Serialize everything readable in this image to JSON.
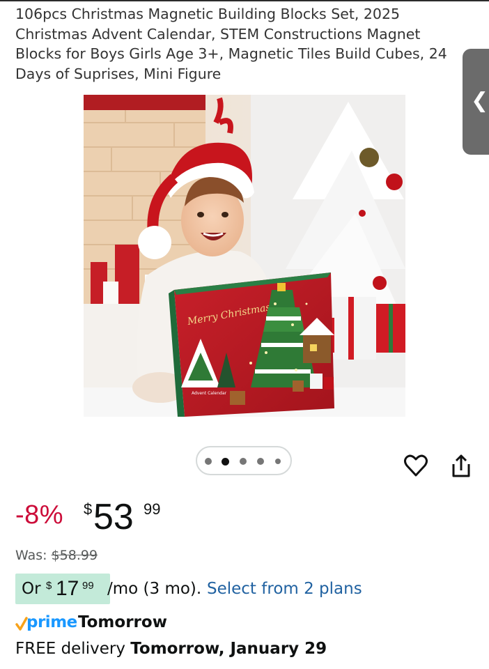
{
  "product": {
    "title": "106pcs Christmas Magnetic Building Blocks Set, 2025 Christmas Advent Calendar, STEM Constructions Magnet Blocks for Boys Girls Age 3+, Magnetic Tiles Build Cubes, 24 Days of Suprises, Mini Figure"
  },
  "gallery": {
    "box_script": "Merry Christmas",
    "box_small_text": "Advent Calendar",
    "dot_count": 5,
    "active_index": 1
  },
  "pricing": {
    "discount": "-8%",
    "currency_symbol": "$",
    "price_whole": "53",
    "price_fraction": "99",
    "was_label": "Was:",
    "was_price": "$58.99"
  },
  "installment": {
    "prefix": "Or",
    "currency_symbol": "$",
    "whole": "17",
    "fraction": "99",
    "term": "/mo (3 mo).",
    "link_text": "Select from 2 plans"
  },
  "delivery": {
    "prime_label": "prime",
    "prime_day": "Tomorrow",
    "free_prefix": "FREE delivery",
    "date": "Tomorrow, January 29"
  },
  "colors": {
    "discount_red": "#cc0c39",
    "link_blue": "#2162a1",
    "prime_blue": "#1a98ff",
    "prime_check_orange": "#f7a21b",
    "plan_badge_green": "#c3ead9"
  },
  "icons": [
    "chevron-left-icon",
    "heart-icon",
    "share-icon",
    "prime-check-icon"
  ]
}
